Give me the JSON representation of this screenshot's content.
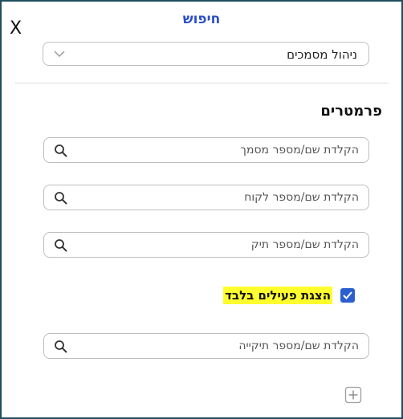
{
  "header": {
    "close_label": "X",
    "title": "חיפוש"
  },
  "module_select": {
    "value": "ניהול מסמכים",
    "icon": "chevron-down-icon"
  },
  "section_title": "פרמטרים",
  "fields": [
    {
      "placeholder": "הקלדת שם/מספר מסמך",
      "value": "",
      "icon": "search-icon"
    },
    {
      "placeholder": "הקלדת שם/מספר לקוח",
      "value": "",
      "icon": "search-icon"
    },
    {
      "placeholder": "הקלדת שם/מספר תיק",
      "value": "",
      "icon": "search-icon"
    },
    {
      "placeholder": "הקלדת שם/מספר תיקייה",
      "value": "",
      "icon": "search-icon"
    }
  ],
  "active_only": {
    "label": "הצגת פעילים בלבד",
    "checked": true,
    "highlight_color": "#ffff2e"
  },
  "add_button": {
    "icon": "plus-square-icon"
  },
  "colors": {
    "accent": "#2b4fc7",
    "checkbox": "#2b5fcf",
    "border": "#1f4e5f"
  }
}
